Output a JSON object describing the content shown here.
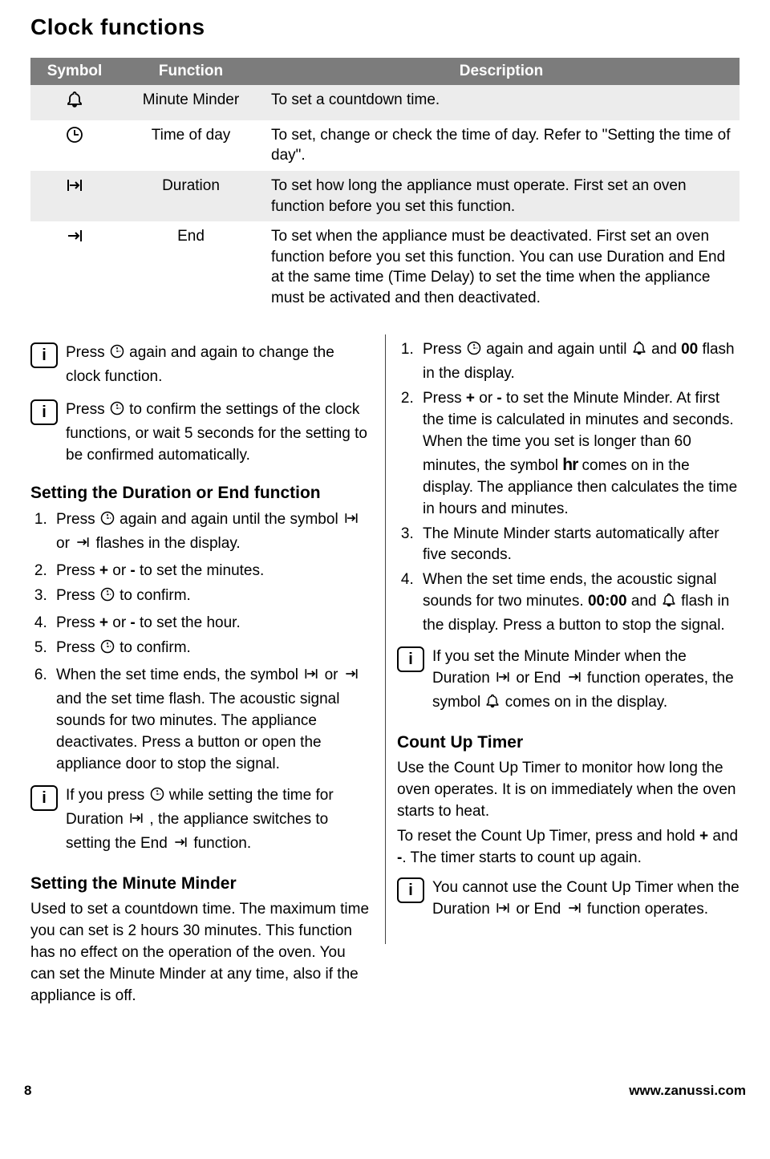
{
  "title": "Clock functions",
  "table": {
    "headers": [
      "Symbol",
      "Function",
      "Description"
    ],
    "rows": [
      {
        "symbol": "bell",
        "function": "Minute Minder",
        "description": "To set a countdown time."
      },
      {
        "symbol": "clock",
        "function": "Time of day",
        "description": "To set, change or check the time of day. Refer to \"Setting the time of day\"."
      },
      {
        "symbol": "duration",
        "function": "Duration",
        "description": "To set how long the appliance must operate. First set an oven function before you set this function."
      },
      {
        "symbol": "end",
        "function": "End",
        "description": "To set when the appliance must be deactivated. First set an oven function before you set this function. You can use Duration and End at the same time (Time Delay) to set the time when the appliance must be activated and then deactivated."
      }
    ]
  },
  "left": {
    "note1_a": "Press ",
    "note1_b": " again and again to change the clock function.",
    "note2_a": "Press ",
    "note2_b": " to confirm the settings of the clock functions, or wait 5 seconds for the setting to be confirmed automatically.",
    "h1": "Setting the Duration or End function",
    "s1_a": "Press ",
    "s1_b": " again and again until the symbol ",
    "s1_c": " or ",
    "s1_d": " flashes in the display.",
    "s2": "Press + or - to set the minutes.",
    "s3_a": "Press ",
    "s3_b": " to confirm.",
    "s4": "Press + or - to set the hour.",
    "s5_a": "Press ",
    "s5_b": " to confirm.",
    "s6_a": "When the set time ends, the symbol ",
    "s6_b": " or ",
    "s6_c": " and the set time flash. The acoustic signal sounds for two minutes. The appliance deactivates. Press a button or open the appliance door to stop the signal.",
    "note3_a": "If you press ",
    "note3_b": " while setting the time for Duration ",
    "note3_c": " , the appliance switches to setting the End ",
    "note3_d": " function.",
    "h2": "Setting the Minute Minder",
    "mm": "Used to set a countdown time. The maximum time you can set is 2 hours 30 minutes. This function has no effect on the operation of the oven. You can set the Minute Minder at any time, also if the appliance is off."
  },
  "right": {
    "r1_a": "Press ",
    "r1_b": " again and again until ",
    "r1_c": " and ",
    "r1_d": "00",
    "r1_e": " flash in the display.",
    "r2_a": "Press ",
    "r2_b": "+",
    "r2_c": " or ",
    "r2_d": "-",
    "r2_e": " to set the Minute Minder. At first the time is calculated in minutes and seconds. When the time you set is longer than 60 minutes, the symbol ",
    "r2_f": "hr",
    "r2_g": " comes on in the display. The appliance then calculates the time in hours and minutes.",
    "r3": "The Minute Minder starts automatically after five seconds.",
    "r4_a": "When the set time ends, the acoustic signal sounds for two minutes. ",
    "r4_b": "00:00",
    "r4_c": " and ",
    "r4_d": " flash in the display. Press a button to stop the signal.",
    "noteR_a": "If you set the Minute Minder when the Duration ",
    "noteR_b": " or End ",
    "noteR_c": " function operates, the symbol ",
    "noteR_d": " comes on in the display.",
    "h3": "Count Up Timer",
    "cu1": "Use the Count Up Timer to monitor how long the oven operates. It is on immediately when the oven starts to heat.",
    "cu2_a": "To reset the Count Up Timer, press and hold ",
    "cu2_b": "+",
    "cu2_c": " and ",
    "cu2_d": "-",
    "cu2_e": ". The timer starts to count up again.",
    "noteR2_a": "You cannot use the Count Up Timer when the Duration ",
    "noteR2_b": " or End ",
    "noteR2_c": " function operates."
  },
  "footer": {
    "page": "8",
    "url": "www.zanussi.com"
  }
}
